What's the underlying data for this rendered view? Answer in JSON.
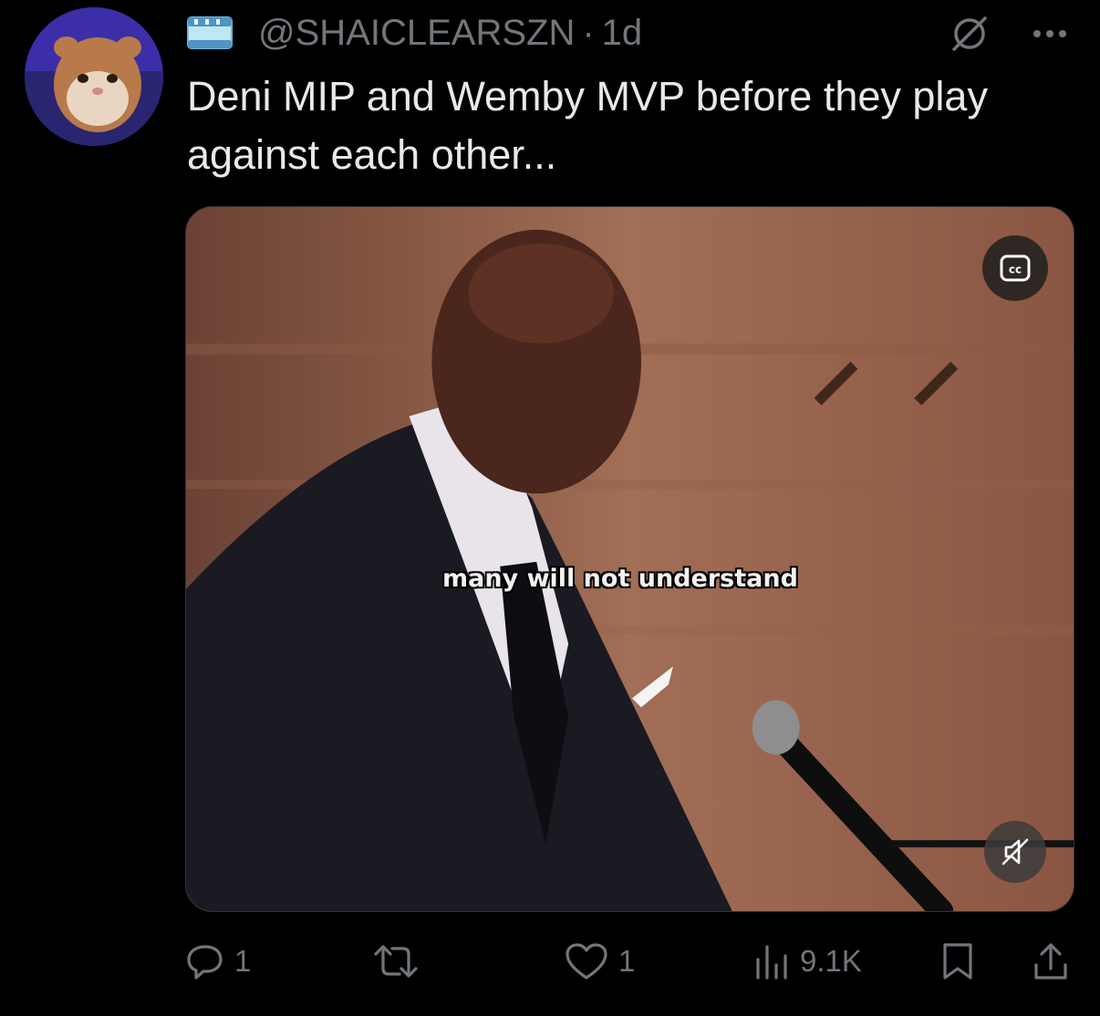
{
  "tweet": {
    "handle": "@SHAICLEARSZN",
    "separator": "·",
    "time": "1d",
    "text": "Deni MIP and Wemby MVP before they play against each other...",
    "media": {
      "caption": "many will not understand",
      "cc_icon": "closed-captions-icon",
      "mute_icon": "muted-speaker-icon"
    },
    "actions": {
      "replies": "1",
      "retweets": "",
      "likes": "1",
      "views": "9.1K"
    },
    "icons": {
      "flag": "flag-icon",
      "grok": "grok-icon",
      "more": "more-icon",
      "reply": "reply-icon",
      "retweet": "retweet-icon",
      "like": "heart-icon",
      "views": "views-icon",
      "bookmark": "bookmark-icon",
      "share": "share-icon"
    },
    "colors": {
      "background": "#000000",
      "text": "#e7e9ea",
      "muted": "#71767b"
    }
  }
}
